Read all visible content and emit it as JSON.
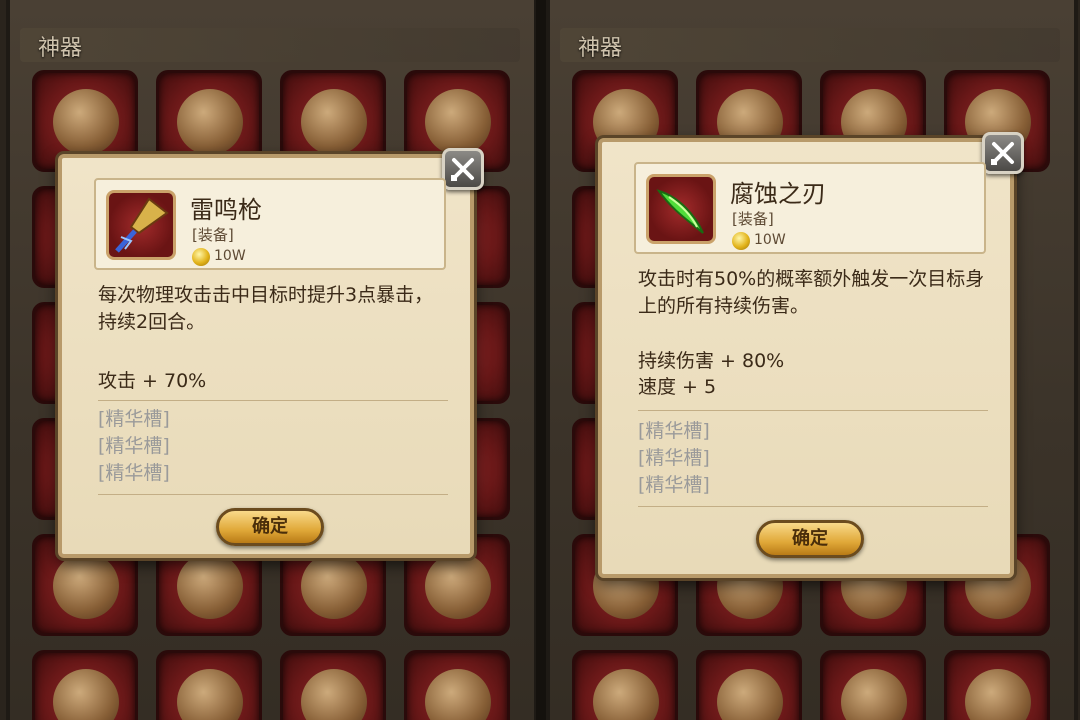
{
  "left_panel": {
    "section_title": "神器",
    "popup": {
      "item_name": "雷鸣枪",
      "item_type": "[装备]",
      "price": "10W",
      "icon": "spear-icon",
      "description": "每次物理攻击击中目标时提升3点暴击，持续2回合。",
      "stats": [
        "攻击 + 70%"
      ],
      "essence_slots": [
        "[精华槽]",
        "[精华槽]",
        "[精华槽]"
      ],
      "confirm_label": "确定"
    }
  },
  "right_panel": {
    "section_title": "神器",
    "popup": {
      "item_name": "腐蚀之刃",
      "item_type": "[装备]",
      "price": "10W",
      "icon": "blade-icon",
      "description": "攻击时有50%的概率额外触发一次目标身上的所有持续伤害。",
      "stats": [
        "持续伤害 + 80%",
        "速度 + 5"
      ],
      "essence_slots": [
        "[精华槽]",
        "[精华槽]",
        "[精华槽]"
      ],
      "confirm_label": "确定"
    }
  },
  "colors": {
    "popup_bg": "#f0e4c8",
    "slot_red": "#6a1818",
    "confirm_gold": "#e0a838",
    "muted_text": "#9a9a9a"
  }
}
